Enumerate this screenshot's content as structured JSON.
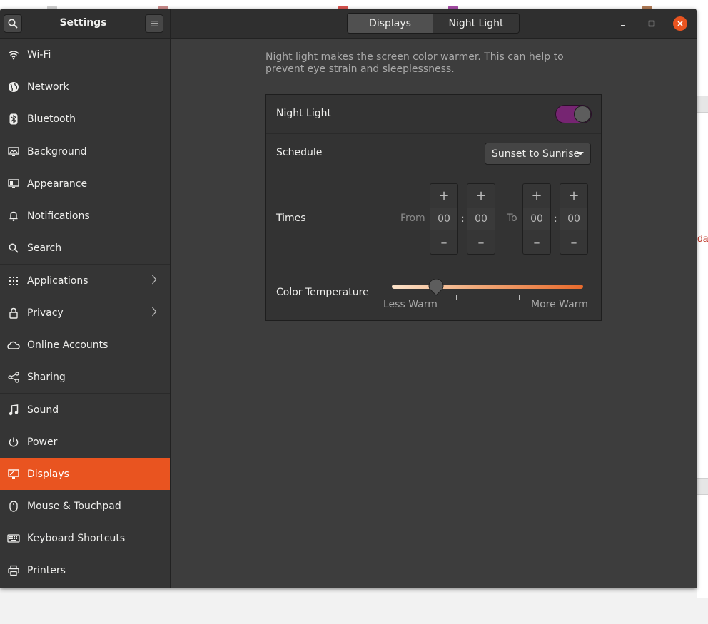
{
  "window": {
    "title": "Settings",
    "tabs": [
      {
        "label": "Displays",
        "active": true
      },
      {
        "label": "Night Light",
        "active": false
      }
    ]
  },
  "sidebar": {
    "items": [
      {
        "label": "Wi-Fi",
        "icon": "wifi-icon"
      },
      {
        "label": "Network",
        "icon": "globe-icon"
      },
      {
        "label": "Bluetooth",
        "icon": "bluetooth-icon"
      },
      {
        "label": "Background",
        "icon": "background-icon"
      },
      {
        "label": "Appearance",
        "icon": "appearance-icon"
      },
      {
        "label": "Notifications",
        "icon": "bell-icon"
      },
      {
        "label": "Search",
        "icon": "search-icon"
      },
      {
        "label": "Applications",
        "icon": "grid-icon",
        "has_submenu": true
      },
      {
        "label": "Privacy",
        "icon": "lock-icon",
        "has_submenu": true
      },
      {
        "label": "Online Accounts",
        "icon": "cloud-icon"
      },
      {
        "label": "Sharing",
        "icon": "share-icon"
      },
      {
        "label": "Sound",
        "icon": "music-note-icon"
      },
      {
        "label": "Power",
        "icon": "power-icon"
      },
      {
        "label": "Displays",
        "icon": "display-icon",
        "active": true
      },
      {
        "label": "Mouse & Touchpad",
        "icon": "mouse-icon"
      },
      {
        "label": "Keyboard Shortcuts",
        "icon": "keyboard-icon"
      },
      {
        "label": "Printers",
        "icon": "printer-icon"
      }
    ]
  },
  "night_light": {
    "description": "Night light makes the screen color warmer. This can help to prevent eye strain and sleeplessness.",
    "toggle_label": "Night Light",
    "toggle_on": true,
    "schedule_label": "Schedule",
    "schedule_value": "Sunset to Sunrise",
    "times_label": "Times",
    "from_label": "From",
    "to_label": "To",
    "from_hours": "00",
    "from_minutes": "00",
    "to_hours": "00",
    "to_minutes": "00",
    "colon": ":",
    "plus": "+",
    "minus": "–",
    "color_temp_label": "Color Temperature",
    "less_warm": "Less Warm",
    "more_warm": "More Warm",
    "color_temp_fraction": 0.23
  },
  "background_app": {
    "partial_text": "da"
  },
  "colors": {
    "accent": "#e95420",
    "toggle_on": "#762572",
    "window_bg": "#3d3d3d",
    "sidebar_bg": "#353535"
  }
}
